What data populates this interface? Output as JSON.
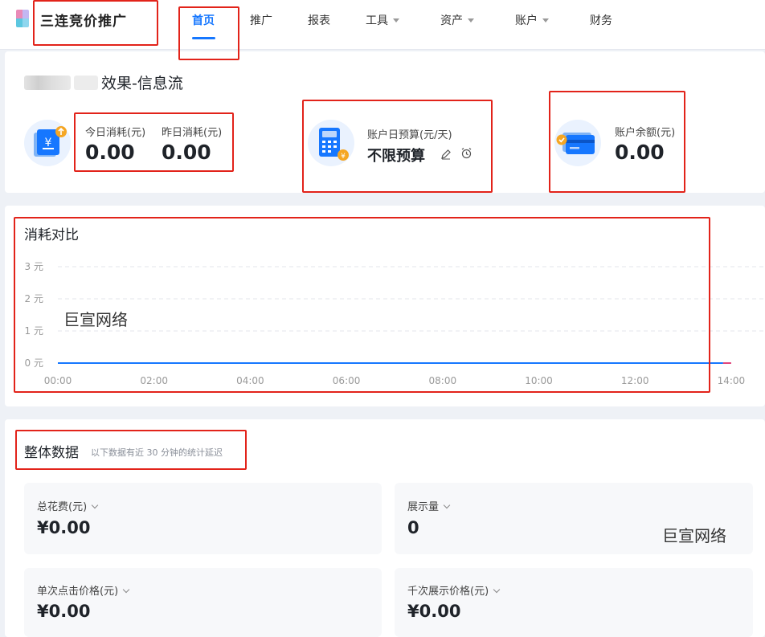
{
  "app": {
    "title": "三连竞价推广"
  },
  "nav": {
    "items": [
      {
        "label": "首页",
        "active": true,
        "dropdown": false
      },
      {
        "label": "推广",
        "active": false,
        "dropdown": false
      },
      {
        "label": "报表",
        "active": false,
        "dropdown": false
      },
      {
        "label": "工具",
        "active": false,
        "dropdown": true
      },
      {
        "label": "资产",
        "active": false,
        "dropdown": true
      },
      {
        "label": "账户",
        "active": false,
        "dropdown": true
      },
      {
        "label": "财务",
        "active": false,
        "dropdown": false
      }
    ]
  },
  "account": {
    "name_suffix": "效果-信息流",
    "today_cost_label": "今日消耗(元)",
    "today_cost_value": "0.00",
    "yesterday_cost_label": "昨日消耗(元)",
    "yesterday_cost_value": "0.00",
    "daily_budget_label": "账户日预算(元/天)",
    "daily_budget_value": "不限预算",
    "balance_label": "账户余额(元)",
    "balance_value": "0.00"
  },
  "chart_section": {
    "title": "消耗对比"
  },
  "chart_data": {
    "type": "line",
    "title": "消耗对比",
    "xlabel": "",
    "ylabel": "",
    "x_ticks": [
      "00:00",
      "02:00",
      "04:00",
      "06:00",
      "08:00",
      "10:00",
      "12:00",
      "14:00"
    ],
    "y_ticks": [
      "0 元",
      "1 元",
      "2 元",
      "3 元"
    ],
    "ylim": [
      0,
      3
    ],
    "xlim": [
      "00:00",
      "14:00"
    ],
    "grid": true,
    "series": [
      {
        "color": "#1677ff",
        "x": [
          "00:00",
          "13:50"
        ],
        "values": [
          0,
          0
        ]
      },
      {
        "color": "#e0447a",
        "x": [
          "13:50",
          "14:00"
        ],
        "values": [
          0,
          0
        ]
      }
    ]
  },
  "overall": {
    "title": "整体数据",
    "note": "以下数据有近 30 分钟的统计延迟",
    "metrics": [
      {
        "label": "总花费(元)",
        "value": "¥0.00"
      },
      {
        "label": "展示量",
        "value": "0"
      },
      {
        "label": "单次点击价格(元)",
        "value": "¥0.00"
      },
      {
        "label": "千次展示价格(元)",
        "value": "¥0.00"
      }
    ]
  },
  "watermarks": {
    "text": "巨宣网络"
  },
  "colors": {
    "accent": "#1677ff",
    "highlight_box": "#e2231a",
    "coin": "#f5a623"
  }
}
